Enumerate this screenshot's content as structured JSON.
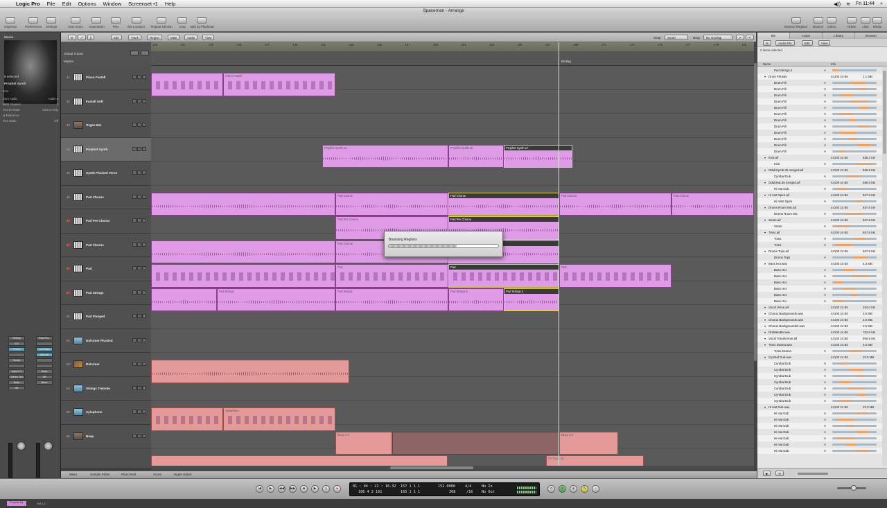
{
  "menubar": {
    "app": "Logic Pro",
    "items": [
      "File",
      "Edit",
      "Options",
      "Window",
      "Screenset •1",
      "Help"
    ],
    "clock": "Fri 11:44"
  },
  "window_title": "Spaceman - Arrange",
  "toolbar_left": [
    "Inspector",
    "Preferences",
    "Settings",
    "Auto Zoom",
    "Automation",
    "Flex",
    "Set Locators",
    "Repeat Section",
    "Crop",
    "Split by Playhead"
  ],
  "toolbar_right": [
    "Bounce Regions",
    "Bounce",
    "Colors",
    "Notes",
    "Lists",
    "Media"
  ],
  "inspector": {
    "selected_count": "6 selected",
    "region_name": "Prophet Synth",
    "rows": [
      [
        "Icon",
        ""
      ],
      [
        "Core Audio",
        "Audio 6"
      ],
      [
        "MIDI Channel",
        "3"
      ],
      [
        "Freeze Mode",
        "Source Only"
      ],
      [
        "Q-Reference",
        ""
      ],
      [
        "Flex Mode",
        "Off"
      ]
    ],
    "strip1": {
      "setting": "Setting",
      "eq": "EQ",
      "plugin": "PHerb",
      "sends": "Sends",
      "io": "Input 1-2",
      "out": "Stereo Out",
      "read": "Read",
      "off": "Off",
      "name": "Prophet Sy"
    },
    "strip2": {
      "setting": "Final Pro..",
      "plugin1": "LinPhase",
      "plugin2": "AdLimit",
      "io": "Out 1-2",
      "read": "Read",
      "off": "Off",
      "bnce": "Bnce"
    },
    "category": "Movie"
  },
  "arrange_menus": [
    "Edit",
    "Track",
    "Region",
    "MIDI",
    "Audio",
    "View"
  ],
  "arrange_right": {
    "snap_label": "Snap:",
    "snap": "Smart",
    "drag_label": "Drag:",
    "drag": "No Overlap"
  },
  "global_tracks": {
    "label": "Global Tracks",
    "marker": "Marker",
    "ending": "Ending"
  },
  "ruler": [
    "139",
    "141",
    "143",
    "145",
    "147",
    "149",
    "151",
    "153",
    "155",
    "157",
    "159",
    "161",
    "163",
    "165",
    "167",
    "169",
    "171",
    "173",
    "175",
    "177",
    "179",
    "181"
  ],
  "tracks": [
    {
      "num": "41",
      "name": "Piano Fastell",
      "icon": "keys"
    },
    {
      "num": "42",
      "name": "Fastell Soft",
      "icon": "keys"
    },
    {
      "num": "43",
      "name": "Organ 60s",
      "icon": "wood"
    },
    {
      "num": "44",
      "name": "Prophet Synth",
      "icon": "keys"
    },
    {
      "num": "45",
      "name": "Synth Plucked Verse",
      "icon": "keys"
    },
    {
      "num": "46",
      "name": "Pad Chorus",
      "icon": "keys"
    },
    {
      "num": "47",
      "name": "Pad Pre Chorus",
      "icon": "keys"
    },
    {
      "num": "48",
      "name": "Pad Chorus",
      "icon": "keys"
    },
    {
      "num": "49",
      "name": "Pad",
      "icon": "keys"
    },
    {
      "num": "50",
      "name": "Pad Strings",
      "icon": "keys"
    },
    {
      "num": "51",
      "name": "Pad Flanged",
      "icon": "keys"
    },
    {
      "num": "52",
      "name": "Dulcimer Plucked",
      "icon": "blue"
    },
    {
      "num": "53",
      "name": "Dulcimer",
      "icon": "guit"
    },
    {
      "num": "54",
      "name": "Strings Tremolo",
      "icon": "blue"
    },
    {
      "num": "55",
      "name": "Xylophone",
      "icon": "blue"
    },
    {
      "num": "56",
      "name": "Beep",
      "icon": "wood"
    }
  ],
  "regions": {
    "r1": "Piano Fastell",
    "r2": "Prophet Synth.14",
    "r3": "Prophet Synth.16",
    "r4": "Prophet Synth.17",
    "r5": "Pad Chorus",
    "r6": "Pad Chorus",
    "r7": "Pad Chorus",
    "r8": "Pad Chorus",
    "r9": "Pad Pre Chorus",
    "r10": "Pad Pre Chorus",
    "r11": "Pad Chorus",
    "r12": "Pad",
    "r13": "Pad",
    "r14": "Pad",
    "r15": "Pad Strings",
    "r16": "Pad Strings",
    "r17": "Pad Strings.2",
    "r18": "Pad Strings.3",
    "r19": "Xylophone",
    "r20": "Beep 4.9",
    "r21": "Beep 4.9",
    "r22": "FX Track 19"
  },
  "dialog": {
    "title": "Bouncing Regions",
    "progress": 0.62
  },
  "bottom_tabs": [
    "Mixer",
    "Sample Editor",
    "Piano Roll",
    "Score",
    "Hyper Editor"
  ],
  "transport": {
    "pos1": "01 : 04 : 21 : 16.32",
    "pos2": "186  4  2  161",
    "bars1": "157  1  1  1",
    "bars2": "165  1  1  1",
    "tempo": "152.0000",
    "tempo_sub": "308",
    "sig": "4/4",
    "sig_sub": "/16",
    "in": "No In",
    "out": "No Out"
  },
  "right_panel": {
    "tabs": [
      "Bin",
      "Loops",
      "Library",
      "Browser"
    ],
    "menus": [
      "Audio File",
      "Edit",
      "View"
    ],
    "selected": "2 items selected",
    "col_name": "Name",
    "col_info": "Info",
    "files": [
      [
        "Pad Strings.2",
        "",
        ""
      ],
      [
        "Drum Fill.wav",
        "44100 24 Bit",
        "1.1 MB"
      ],
      [
        "Drum Fill",
        "",
        ""
      ],
      [
        "Drum Fill",
        "",
        ""
      ],
      [
        "Drum Fill",
        "",
        ""
      ],
      [
        "Drum Fill",
        "",
        ""
      ],
      [
        "Drum Fill",
        "",
        ""
      ],
      [
        "Drum Fill",
        "",
        ""
      ],
      [
        "Drum Fill",
        "",
        ""
      ],
      [
        "Drum Fill",
        "",
        ""
      ],
      [
        "Drum Fill",
        "",
        ""
      ],
      [
        "Drum Fill",
        "",
        ""
      ],
      [
        "Drum Fill",
        "",
        ""
      ],
      [
        "Drum Fill",
        "",
        ""
      ],
      [
        "Kick.aif",
        "44100 24 Bit",
        "586.2 KB"
      ],
      [
        "Kick",
        "",
        ""
      ],
      [
        "OdubCymb.35 merged.aif",
        "44100 24 Bit",
        "586.5 KB"
      ],
      [
        "Cymbal Dub",
        "",
        ""
      ],
      [
        "OdubHat.35 merged.aif",
        "44100 24 Bit",
        "586.5 KB"
      ],
      [
        "Hi Hat Dub",
        "",
        ""
      ],
      [
        "Hi Hat Open.aif",
        "44100 24 Bit",
        "567.6 KB"
      ],
      [
        "Hi Hats Open",
        "",
        ""
      ],
      [
        "Drums Room Mic.aif",
        "44100 24 Bit",
        "567.6 KB"
      ],
      [
        "Drums Room Mic",
        "",
        ""
      ],
      [
        "Snare.aif",
        "44100 24 Bit",
        "567.6 KB"
      ],
      [
        "Snare",
        "",
        ""
      ],
      [
        "Toms.aif",
        "44100 24 Bit",
        "567.6 KB"
      ],
      [
        "Toms",
        "",
        ""
      ],
      [
        "Toms",
        "",
        ""
      ],
      [
        "Drums Tops.aif",
        "44100 24 Bit",
        "567.6 KB"
      ],
      [
        "Drums Tops",
        "",
        ""
      ],
      [
        "Bass Hot.wav",
        "44100 24 Bit",
        "5.3 MB"
      ],
      [
        "Bass Hot",
        "",
        ""
      ],
      [
        "Bass Hot",
        "",
        ""
      ],
      [
        "Bass Hot",
        "",
        ""
      ],
      [
        "Bass Hot",
        "",
        ""
      ],
      [
        "Bass Hot",
        "",
        ""
      ],
      [
        "Bass Hot",
        "",
        ""
      ],
      [
        "Vocal Verse.aif",
        "44100 24 Bit",
        "484.0 KB"
      ],
      [
        "Chorus Backgrounds.wav",
        "44100 24 Bit",
        "3.5 MB"
      ],
      [
        "Chorus Backgrounds.wav",
        "44100 24 Bit",
        "2.5 MB"
      ],
      [
        "Chorus Backgrounds2.wav",
        "44100 24 Bit",
        "3.5 MB"
      ],
      [
        "DrdMeloBV.wav",
        "44100 24 Bit",
        "752.6 KB"
      ],
      [
        "Vocal Transformer.aif",
        "44100 24 Bit",
        "950.5 KB"
      ],
      [
        "Toms Drama.wav",
        "44100 24 Bit",
        "3.6 MB"
      ],
      [
        "Toms Drama",
        "",
        ""
      ],
      [
        "Cymbal Dub.wav",
        "44100 24 Bit",
        "10.5 MB"
      ],
      [
        "Cymbal Dub",
        "",
        ""
      ],
      [
        "Cymbal Dub",
        "",
        ""
      ],
      [
        "Cymbal Dub",
        "",
        ""
      ],
      [
        "Cymbal Dub",
        "",
        ""
      ],
      [
        "Cymbal Dub",
        "",
        ""
      ],
      [
        "Cymbal Dub",
        "",
        ""
      ],
      [
        "Cymbal Dub",
        "",
        ""
      ],
      [
        "Hi Hat Dub.wav",
        "44100 24 Bit",
        "23.0 MB"
      ],
      [
        "Hi Hat Dub",
        "",
        ""
      ],
      [
        "Hi Hat Dub",
        "",
        ""
      ],
      [
        "Hi Hat Dub",
        "",
        ""
      ],
      [
        "Hi Hat Dub",
        "",
        ""
      ],
      [
        "Hi Hat Dub",
        "",
        ""
      ],
      [
        "Hi Hat Dub",
        "",
        ""
      ],
      [
        "Hi Hat Dub",
        "",
        ""
      ]
    ]
  }
}
